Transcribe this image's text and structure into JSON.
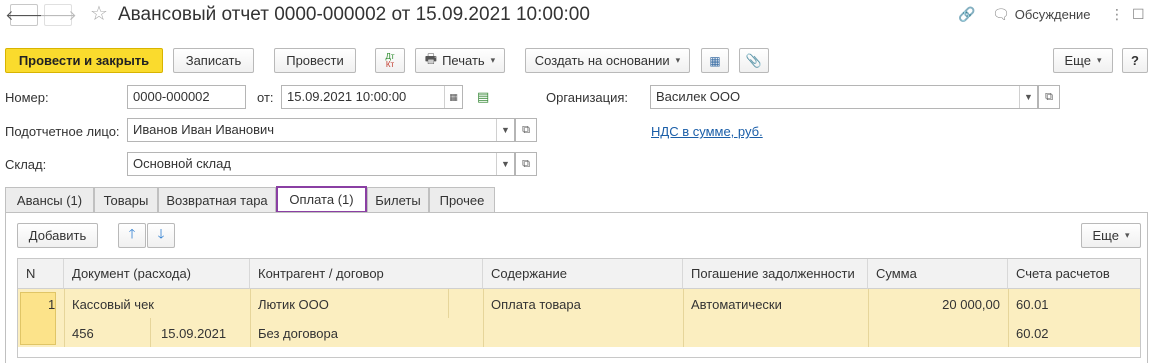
{
  "window": {
    "title": "Авансовый отчет 0000-000002 от 15.09.2021 10:00:00",
    "discussion_label": "Обсуждение"
  },
  "toolbar": {
    "post_close": "Провести и закрыть",
    "save": "Записать",
    "post": "Провести",
    "dtkt_top": "Дт",
    "dtkt_bottom": "Кт",
    "print": "Печать",
    "create_based": "Создать на основании",
    "more": "Еще",
    "help": "?"
  },
  "form": {
    "number_label": "Номер:",
    "number_value": "0000-000002",
    "date_label": "от:",
    "date_value": "15.09.2021 10:00:00",
    "org_label": "Организация:",
    "org_value": "Василек ООО",
    "person_label": "Подотчетное лицо:",
    "person_value": "Иванов Иван Иванович",
    "vat_link": "НДС в сумме, руб.",
    "warehouse_label": "Склад:",
    "warehouse_value": "Основной склад"
  },
  "tabs": [
    {
      "label": "Авансы (1)"
    },
    {
      "label": "Товары"
    },
    {
      "label": "Возвратная тара"
    },
    {
      "label": "Оплата (1)"
    },
    {
      "label": "Билеты"
    },
    {
      "label": "Прочее"
    }
  ],
  "active_tab": "Оплата (1)",
  "table_toolbar": {
    "add": "Добавить",
    "more": "Еще"
  },
  "table": {
    "columns": [
      "N",
      "Документ (расхода)",
      "Контрагент / договор",
      "Содержание",
      "Погашение задолженности",
      "Сумма",
      "Счета расчетов"
    ],
    "rows": [
      {
        "n": "1",
        "doc": "Кассовый чек",
        "doc_number": "456",
        "doc_date": "15.09.2021",
        "counterparty": "Лютик ООО",
        "contract": "Без договора",
        "content": "Оплата товара",
        "repayment": "Автоматически",
        "amount": "20 000,00",
        "account1": "60.01",
        "account2": "60.02"
      }
    ]
  },
  "colors": {
    "primary_button": "#fadb2d",
    "selected_row": "#fbeec0",
    "active_tab_border": "#8a3fa3",
    "link": "#1a5ea8"
  }
}
